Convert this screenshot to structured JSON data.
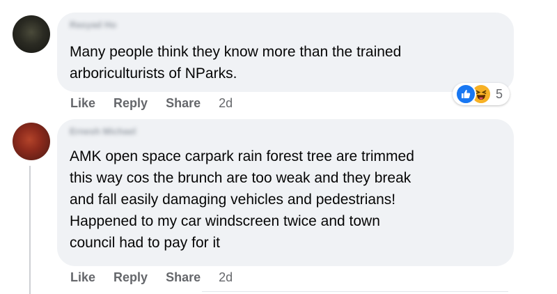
{
  "comments": [
    {
      "author": "Rasyad Ho",
      "text": "Many people think they know more than the trained\narboriculturists of NParks.",
      "actions": {
        "like": "Like",
        "reply": "Reply",
        "share": "Share",
        "time": "2d"
      },
      "reactions": {
        "icons": [
          "like-icon",
          "haha-icon"
        ],
        "count": "5"
      }
    },
    {
      "author": "Ernesh Michael",
      "text": "AMK open space carpark rain forest tree are trimmed\nthis way cos the brunch are too weak and they break\nand fall easily damaging vehicles and pedestrians!\nHappened to my car windscreen twice and town\ncouncil had to pay for it",
      "actions": {
        "like": "Like",
        "reply": "Reply",
        "share": "Share",
        "time": "2d"
      }
    }
  ],
  "colors": {
    "bubble": "#f0f2f5",
    "text": "#050505",
    "secondary_text": "#65676b",
    "like_blue": "#1877f2",
    "haha_yellow": "#f7b125"
  }
}
